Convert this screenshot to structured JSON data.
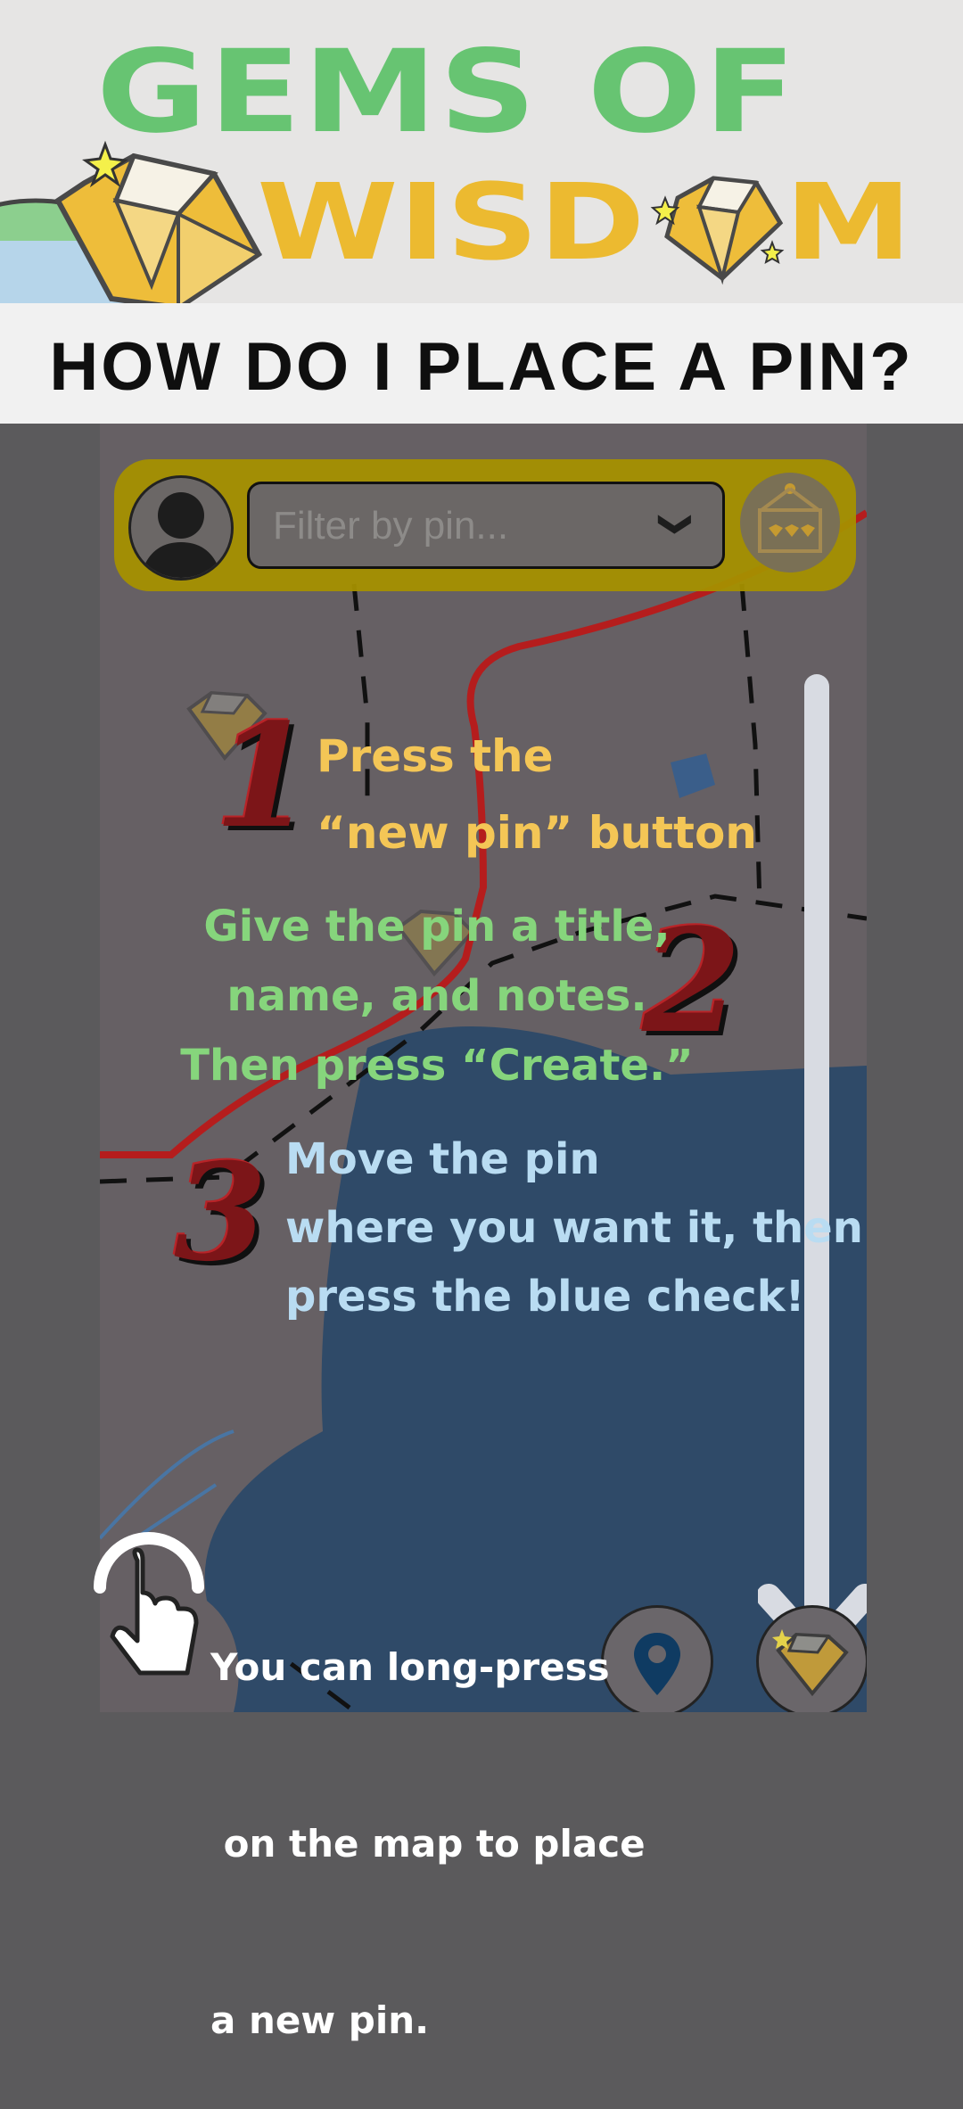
{
  "header": {
    "title_line1": "GEMS OF",
    "title_line2": "WISD",
    "title_line2_end": "M",
    "subtitle": "HOW DO I PLACE A PIN?"
  },
  "app": {
    "filter_placeholder": "Filter by pin...",
    "filter_chevron": "❯"
  },
  "steps": [
    {
      "number": "1",
      "lines": [
        "Press the",
        "“new pin” button"
      ]
    },
    {
      "number": "2",
      "lines": [
        "Give the pin a title,",
        "name, and notes.",
        "Then press “Create.”"
      ]
    },
    {
      "number": "3",
      "lines": [
        "Move the pin",
        "where you want it, then",
        "press the blue check!"
      ]
    }
  ],
  "tip": {
    "lines": [
      "You can long-press",
      " on the map to place",
      "a new pin."
    ]
  },
  "colors": {
    "green": "#67c472",
    "gold": "#ecba30",
    "step1": "#f4c656",
    "step2": "#86d57c",
    "step3": "#b9dcf2",
    "number_red": "#7c1518"
  },
  "icons": [
    "gem-icon",
    "avatar-icon",
    "chevron-down-icon",
    "gem-board-icon",
    "location-pin-icon",
    "hand-pointer-icon",
    "down-arrow-icon"
  ]
}
